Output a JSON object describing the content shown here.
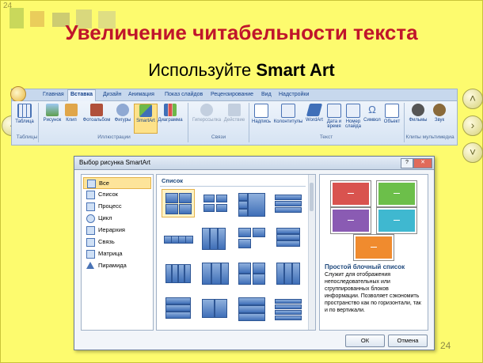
{
  "slide": {
    "corner_number": "24",
    "title": "Увеличение читабельности текста",
    "subtitle_prefix": "Используйте ",
    "subtitle_bold": "Smart Art",
    "page_number": "24"
  },
  "ribbon": {
    "tabs": [
      "Главная",
      "Вставка",
      "Дизайн",
      "Анимация",
      "Показ слайдов",
      "Рецензирование",
      "Вид",
      "Надстройки"
    ],
    "active_tab": "Вставка",
    "buttons": [
      {
        "label": "Таблица",
        "icon": "table-icon"
      },
      {
        "label": "Рисунок",
        "icon": "picture-icon"
      },
      {
        "label": "Клип",
        "icon": "clip-icon"
      },
      {
        "label": "Фотоальбом",
        "icon": "photo-album-icon"
      },
      {
        "label": "Фигуры",
        "icon": "shapes-icon"
      },
      {
        "label": "SmartArt",
        "icon": "smartart-icon"
      },
      {
        "label": "Диаграмма",
        "icon": "chart-icon"
      },
      {
        "label": "Гиперссылка",
        "icon": "hyperlink-icon"
      },
      {
        "label": "Действие",
        "icon": "action-icon"
      },
      {
        "label": "Надпись",
        "icon": "textbox-icon"
      },
      {
        "label": "Колонтитулы",
        "icon": "header-footer-icon"
      },
      {
        "label": "WordArt",
        "icon": "wordart-icon"
      },
      {
        "label": "Дата и время",
        "icon": "date-time-icon"
      },
      {
        "label": "Номер слайда",
        "icon": "slide-number-icon"
      },
      {
        "label": "Символ",
        "icon": "symbol-icon"
      },
      {
        "label": "Объект",
        "icon": "object-icon"
      },
      {
        "label": "Фильмы",
        "icon": "movie-icon"
      },
      {
        "label": "Звук",
        "icon": "sound-icon"
      }
    ],
    "groups": [
      "Таблицы",
      "Иллюстрации",
      "Связи",
      "Текст",
      "Клипы мультимедиа"
    ]
  },
  "dialog": {
    "title": "Выбор рисунка SmartArt",
    "categories": [
      {
        "label": "Все",
        "icon": "all-icon",
        "selected": true
      },
      {
        "label": "Список",
        "icon": "list-icon"
      },
      {
        "label": "Процесс",
        "icon": "process-icon"
      },
      {
        "label": "Цикл",
        "icon": "cycle-icon"
      },
      {
        "label": "Иерархия",
        "icon": "hierarchy-icon"
      },
      {
        "label": "Связь",
        "icon": "relationship-icon"
      },
      {
        "label": "Матрица",
        "icon": "matrix-icon"
      },
      {
        "label": "Пирамида",
        "icon": "pyramid-icon"
      }
    ],
    "grid_header": "Список",
    "preview_colors": [
      "#d9534f",
      "#6cbf4a",
      "#8a5bb3",
      "#3fb8d0",
      "#f08b2e"
    ],
    "preview_title": "Простой блочный список",
    "preview_description": "Служит для отображения непоследовательных или сгруппированных блоков информации. Позволяет сэкономить пространство как по горизонтали, так и по вертикали.",
    "ok_label": "ОК",
    "cancel_label": "Отмена"
  },
  "colors": {
    "background": "#fdfb6e",
    "title": "#c0152b"
  }
}
